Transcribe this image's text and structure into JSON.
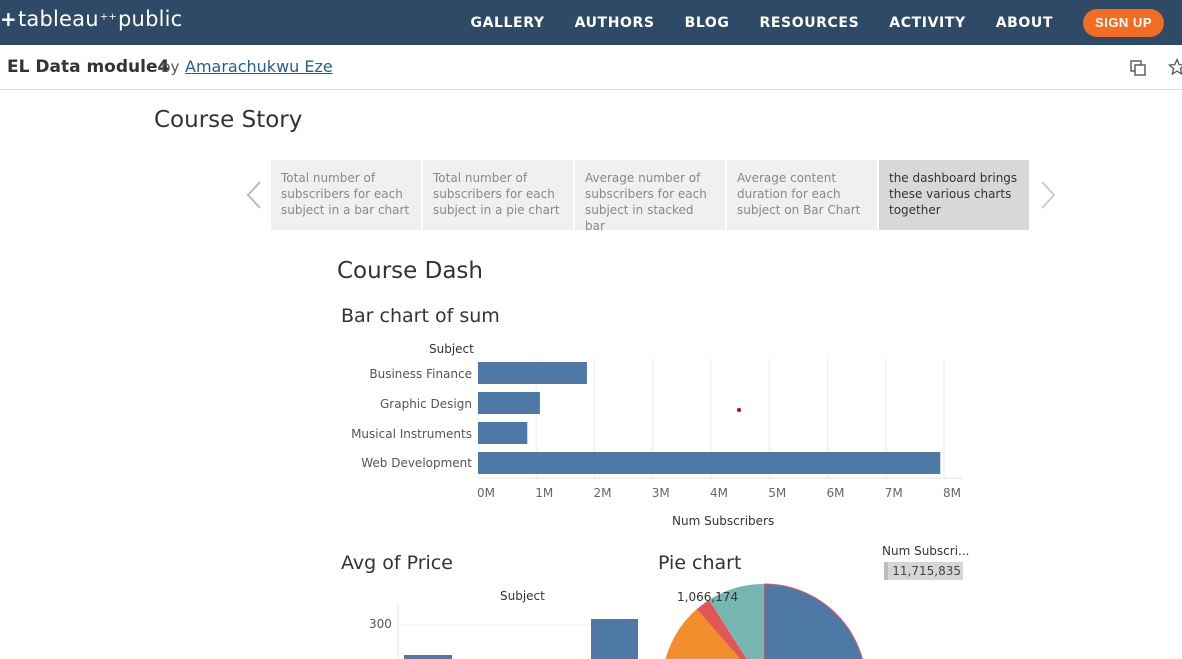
{
  "nav": {
    "logo_left": "tableau",
    "logo_right": "public",
    "links": [
      "GALLERY",
      "AUTHORS",
      "BLOG",
      "RESOURCES",
      "ACTIVITY",
      "ABOUT"
    ],
    "signup": "SIGN UP"
  },
  "viz": {
    "title": "EL Data module4",
    "by": "by",
    "author": "Amarachukwu Eze"
  },
  "story": {
    "title": "Course Story",
    "points": [
      "Total number of subscribers for each subject in a bar chart",
      "Total number of subscribers for each subject in a pie chart",
      "Average number of subscribers for each subject in stacked bar",
      "Average content duration for each subject on Bar Chart",
      "the dashboard brings these various charts together"
    ],
    "active_index": 4
  },
  "dashboard": {
    "title": "Course Dash",
    "avg_title": "Avg of Price",
    "avg_subject_header": "Subject",
    "avg_tick": "300",
    "pie_title": "Pie chart",
    "pie_label": "1,066,174",
    "filter_title": "Num Subscri...",
    "filter_value": "11,715,835"
  },
  "chart_data": {
    "type": "bar",
    "title": "Bar chart of sum",
    "category_header": "Subject",
    "categories": [
      "Business Finance",
      "Graphic Design",
      "Musical Instruments",
      "Web Development"
    ],
    "values": [
      1870000,
      1063000,
      846000,
      7936000
    ],
    "xlabel": "Num Subscribers",
    "xticks": [
      "0M",
      "1M",
      "2M",
      "3M",
      "4M",
      "5M",
      "6M",
      "7M",
      "8M"
    ],
    "xlim": [
      0,
      8000000
    ],
    "grid": true,
    "color": "#4e79a7"
  },
  "colors": {
    "nav_bg": "#2f4a66",
    "signup": "#f26c21",
    "bar": "#4e79a7",
    "pie_orange": "#f28e2b",
    "pie_red": "#e15759",
    "pie_teal": "#76b7b2"
  }
}
